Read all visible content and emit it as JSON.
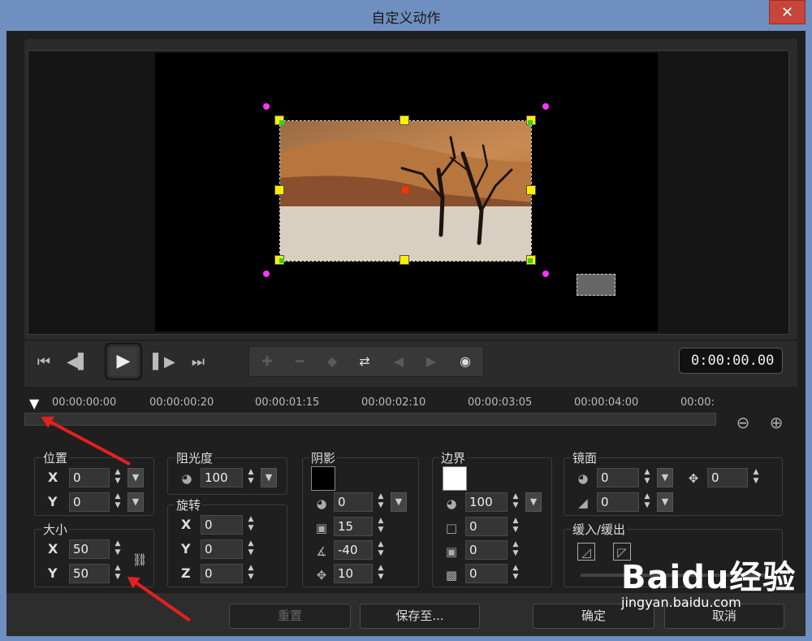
{
  "window": {
    "title": "自定义动作",
    "close": "✕"
  },
  "transport": {
    "buttons": [
      "⏮",
      "◀▌",
      "▌▶",
      "⏭"
    ],
    "play": "▶",
    "tools": [
      "✚",
      "━",
      "◆",
      "⇄",
      "◀",
      "▶",
      "◉"
    ],
    "timecode": "0:00:00.00"
  },
  "timeline": {
    "ticks": [
      "00:00:00:00",
      "00:00:00:20",
      "00:00:01:15",
      "00:00:02:10",
      "00:00:03:05",
      "00:00:04:00",
      "00:00:"
    ],
    "zoom_out": "⊖",
    "zoom_in": "⊕"
  },
  "position": {
    "label": "位置",
    "x_label": "X",
    "x": "0",
    "y_label": "Y",
    "y": "0"
  },
  "size": {
    "label": "大小",
    "x_label": "X",
    "x": "50",
    "y_label": "Y",
    "y": "50",
    "link": "⛓"
  },
  "opacity": {
    "label": "阻光度",
    "value": "100"
  },
  "rotation": {
    "label": "旋转",
    "x_label": "X",
    "x": "0",
    "y_label": "Y",
    "y": "0",
    "z_label": "Z",
    "z": "0"
  },
  "shadow": {
    "label": "阴影",
    "opacity": "0",
    "blur": "15",
    "angle": "-40",
    "distance": "10",
    "color": "#000000"
  },
  "border": {
    "label": "边界",
    "opacity": "100",
    "width": "0",
    "a": "0",
    "b": "0",
    "color": "#ffffff"
  },
  "mirror": {
    "label": "镜面",
    "opacity": "0",
    "offset": "0",
    "gradient": "0"
  },
  "fade": {
    "label": "缓入/缓出"
  },
  "footer": {
    "reset": "重置",
    "save_to": "保存至...",
    "ok": "确定",
    "cancel": "取消"
  },
  "watermark": {
    "text": "Baidu经验",
    "url": "jingyan.baidu.com"
  }
}
